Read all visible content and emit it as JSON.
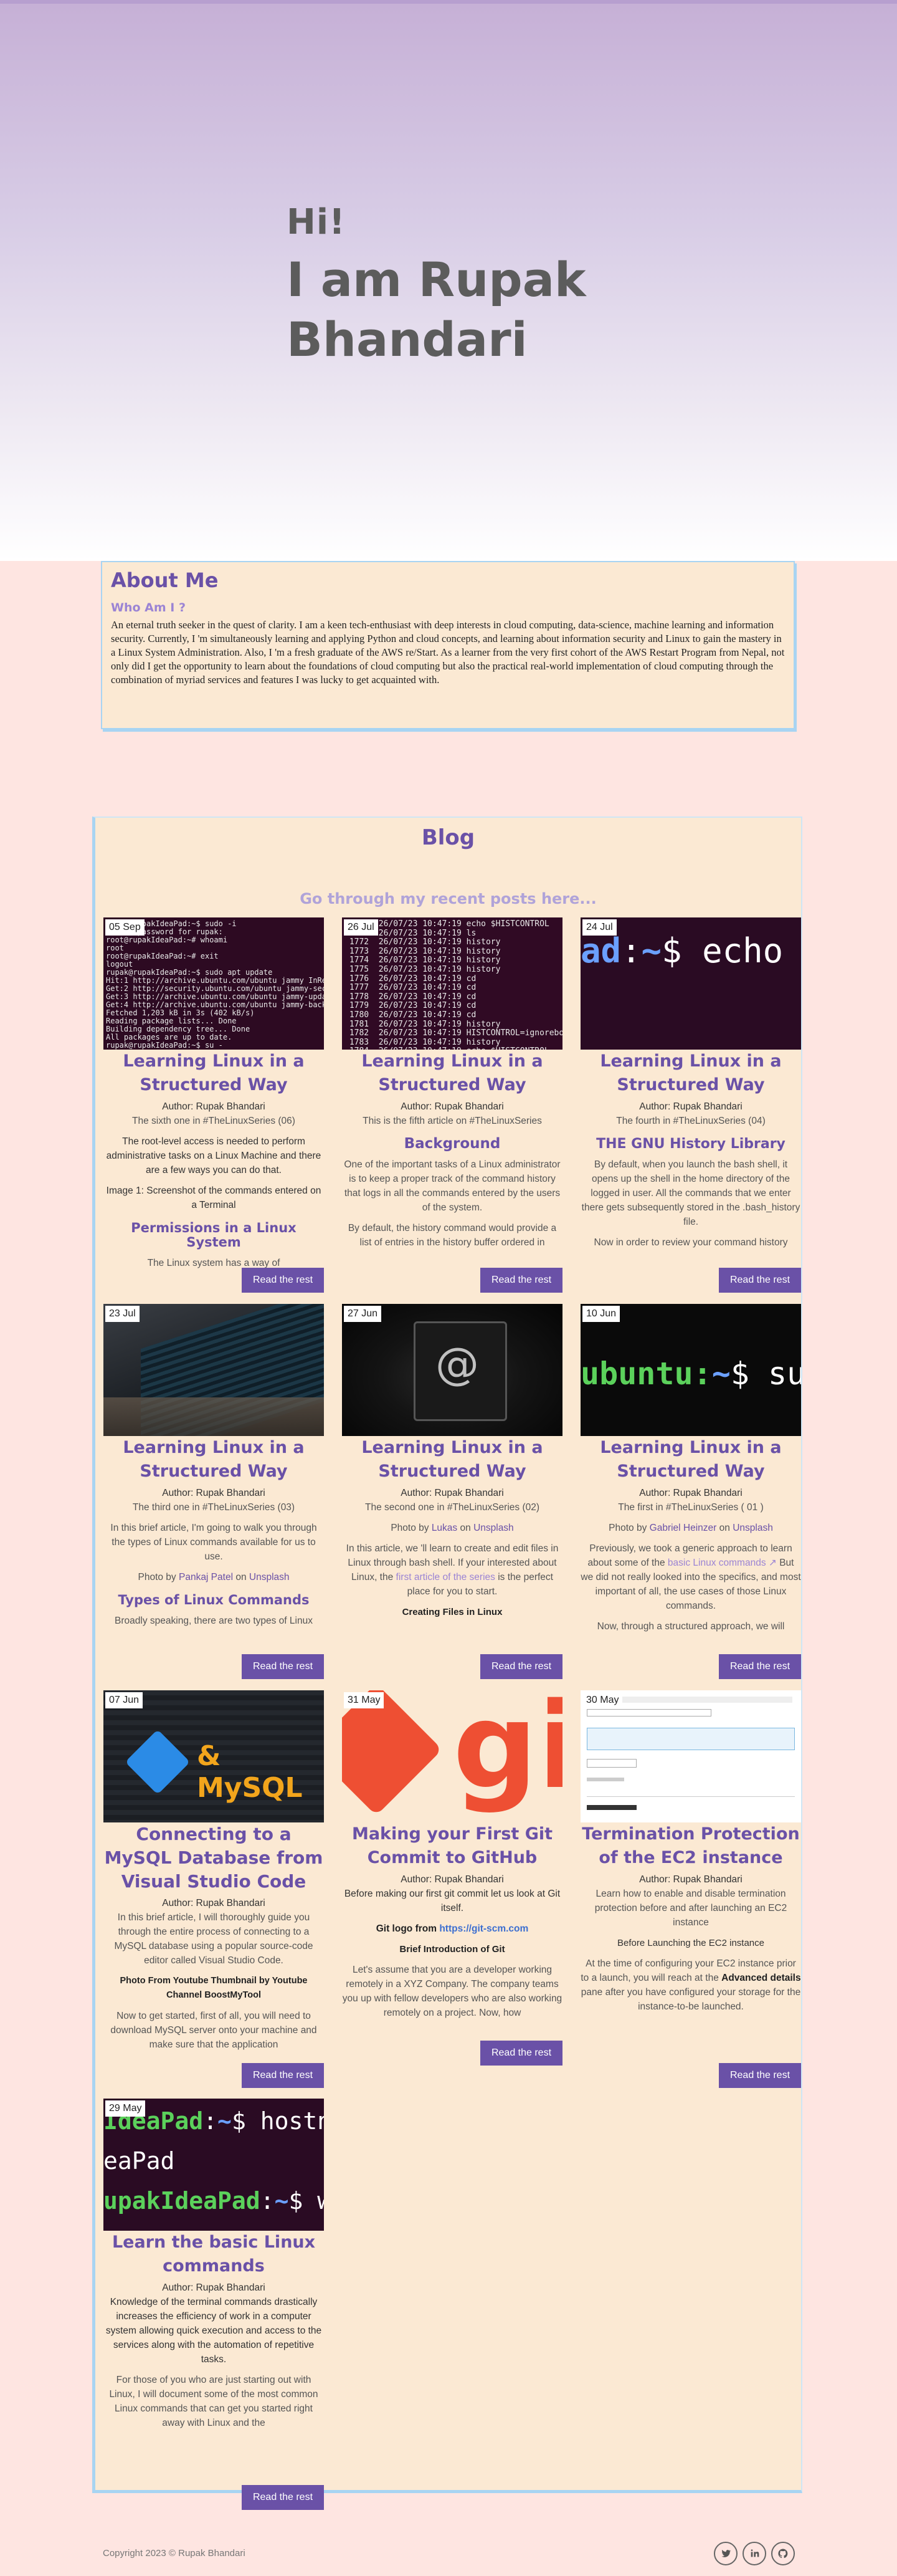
{
  "hero": {
    "greeting": "Hi!",
    "name": "I am Rupak Bhandari"
  },
  "about": {
    "title": "About Me",
    "subtitle": "Who Am I ?",
    "text": "An eternal truth seeker in the quest of clarity. I am a keen tech-enthusiast with deep interests in cloud computing, data-science, machine learning and information security. Currently, I 'm simultaneously learning and applying Python and cloud concepts, and learning about information security and Linux to gain the mastery in a Linux System Administration. Also, I 'm a fresh graduate of the AWS re/Start. As a learner from the very first cohort of the AWS Restart Program from Nepal, not only did I get the opportunity to learn about the foundations of cloud computing but also the practical real-world implementation of cloud computing through the combination of myriad services and features I was lucky to get acquainted with."
  },
  "blog": {
    "title": "Blog",
    "subtitle": "Go through my recent posts here...",
    "read_more": "Read the rest",
    "posts": [
      {
        "date": "05 Sep",
        "title": "Learning Linux in a Structured Way",
        "author": "Author: Rupak Bhandari",
        "series": "The sixth one in #TheLinuxSeries (06)",
        "p1": "The root-level access is needed to perform administrative tasks on a Linux Machine and there are a few ways you can do that.",
        "p2": "Image 1: Screenshot of the commands entered on a Terminal",
        "heading": "Permissions in a Linux System",
        "p3": "The Linux system has a way of"
      },
      {
        "date": "26 Jul",
        "title": "Learning Linux in a Structured Way",
        "author": "Author: Rupak Bhandari",
        "series": "This is the fifth article on #TheLinuxSeries",
        "heading": "Background",
        "p1": "One of the important tasks of a Linux administrator is to keep a proper track of the command history that logs in all the commands entered by the users of the system.",
        "p2": "By default, the history command would provide a list of entries in the history buffer ordered in"
      },
      {
        "date": "24 Jul",
        "title": "Learning Linux in a Structured Way",
        "author": "Author: Rupak Bhandari",
        "series": "The fourth in #TheLinuxSeries (04)",
        "heading": "THE GNU History Library",
        "p1": "By default, when you launch the bash shell, it opens up the shell in the home directory of the logged in user. All the commands that we enter there gets subsequently stored in the .bash_history file.",
        "p2": "Now in order to review your command history"
      },
      {
        "date": "23 Jul",
        "title": "Learning Linux in a Structured Way",
        "author": "Author: Rupak Bhandari",
        "series": "The third one in #TheLinuxSeries (03)",
        "p1": "In this brief article, I'm going to walk you through the types of Linux commands available for us to use.",
        "photo_by": "Photo by",
        "photo_author": "Pankaj Patel",
        "photo_on": "on",
        "photo_site": "Unsplash",
        "heading": "Types of Linux Commands",
        "p2": "Broadly speaking, there are two types of Linux"
      },
      {
        "date": "27 Jun",
        "title": "Learning Linux in a Structured Way",
        "author": "Author: Rupak Bhandari",
        "series": "The second one in #TheLinuxSeries (02)",
        "photo_by": "Photo by",
        "photo_author": "Lukas",
        "photo_on": "on",
        "photo_site": "Unsplash",
        "p1a": "In this article, we 'll learn to create and edit files in Linux through bash shell. If your interested about Linux, the",
        "p1link": "first article of the series",
        "p1b": "is the perfect place for you to start.",
        "subheading": "Creating Files in Linux"
      },
      {
        "date": "10 Jun",
        "title": "Learning Linux in a Structured Way",
        "author": "Author: Rupak Bhandari",
        "series": "The first in #TheLinuxSeries ( 01 )",
        "photo_by": "Photo by",
        "photo_author": "Gabriel Heinzer",
        "photo_on": "on",
        "photo_site": "Unsplash",
        "p1a": "Previously, we took a generic approach to learn about some of the",
        "p1link": "basic Linux commands",
        "p1b": "But we did not really looked into the specifics, and most important of all, the use cases of those Linux commands.",
        "p2": "Now, through a structured approach, we will"
      },
      {
        "date": "07 Jun",
        "title": "Connecting to a MySQL Database from Visual Studio Code",
        "author": "Author: Rupak Bhandari",
        "p1": "In this brief article, I will thoroughly guide you through the entire process of connecting to a MySQL database using a popular source-code editor called Visual Studio Code.",
        "p2": "Photo From Youtube Thumbnail by Youtube Channel BoostMyTool",
        "p3": "Now to get started, first of all, you will need to download MySQL server onto your machine and make sure that the application",
        "thumb_text": "& MySQL"
      },
      {
        "date": "31 May",
        "title": "Making your First Git Commit to GitHub",
        "author": "Author: Rupak Bhandari",
        "p1": "Before making our first git commit let us look at Git itself.",
        "logo_label": "Git logo from",
        "logo_link": "https://git-scm.com",
        "subheading": "Brief Introduction of Git",
        "p2": "Let's assume that you are a developer working remotely in a XYZ Company. The company teams you up with fellow developers who are also working remotely on a project. Now, how",
        "thumb_text": "git"
      },
      {
        "date": "30 May",
        "title": "Termination Protection of the EC2 instance",
        "author": "Author: Rupak Bhandari",
        "p1": "Learn how to enable and disable termination protection before and after launching an EC2 instance",
        "subheading": "Before Launching the EC2 instance",
        "p2a": "At the time of configuring your EC2 instance prior to a launch, you will reach at the",
        "p2b": "Advanced details",
        "p2c": "pane after you have configured your storage for the instance-to-be launched."
      },
      {
        "date": "29 May",
        "title": "Learn the basic Linux commands",
        "author": "Author: Rupak Bhandari",
        "p1": "Knowledge of the terminal commands drastically increases the efficiency of work in a computer system allowing quick execution and access to the services along with the automation of repetitive tasks.",
        "p2": "For those of you who are just starting out with Linux, I will document some of the most common Linux commands that can get you started right away with Linux and the"
      }
    ]
  },
  "footer": {
    "copyright": "Copyright 2023 © Rupak Bhandari",
    "icons": [
      "twitter-icon",
      "linkedin-icon",
      "github-icon"
    ]
  },
  "colors": {
    "accent": "#6a51a7",
    "page_bg": "#fee5e1",
    "panel_bg": "#fbe9d3",
    "border": "#a8d4f2"
  }
}
